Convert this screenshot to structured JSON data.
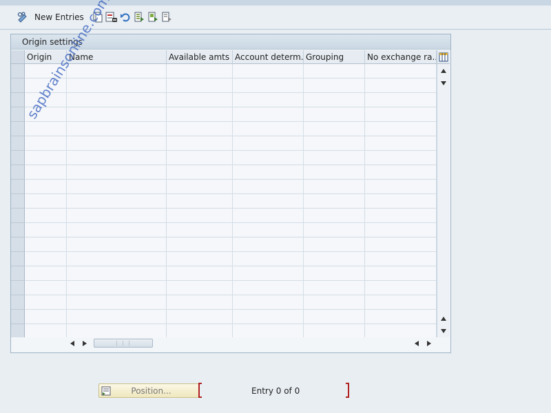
{
  "toolbar": {
    "new_entries_label": "New Entries",
    "icons": [
      "display-change-icon",
      "copy-icon",
      "delete-icon",
      "undo-icon",
      "select-all-icon",
      "select-block-icon",
      "deselect-all-icon"
    ]
  },
  "panel": {
    "title": "Origin settings",
    "columns": [
      "Origin",
      "Name",
      "Available amts",
      "Account determ.",
      "Grouping",
      "No exchange ra..."
    ],
    "row_count": 19,
    "watermark": "sapbrainsonline.com"
  },
  "footer": {
    "position_label": "Position...",
    "entry_info": "Entry 0 of 0"
  },
  "colors": {
    "background": "#e9eef3",
    "header_bg": "#e6ecf2",
    "accent_red": "#b02020",
    "position_button": "#efe7bd",
    "watermark": "#4a6fc4"
  }
}
